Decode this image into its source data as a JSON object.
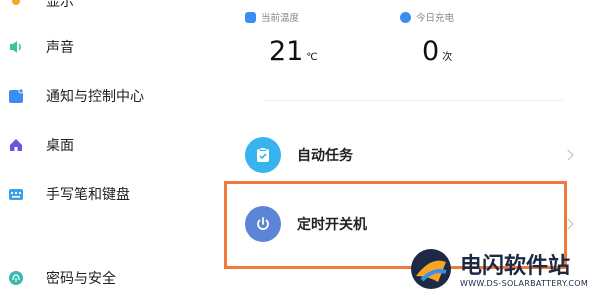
{
  "sidebar": {
    "items": [
      {
        "label": "显示",
        "icon": "sun-icon",
        "color": "#f5a623"
      },
      {
        "label": "声音",
        "icon": "speaker-icon",
        "color": "#3cc48a"
      },
      {
        "label": "通知与控制中心",
        "icon": "notification-icon",
        "color": "#3a8ef0"
      },
      {
        "label": "桌面",
        "icon": "home-icon",
        "color": "#6b55e0"
      },
      {
        "label": "手写笔和键盘",
        "icon": "keyboard-icon",
        "color": "#3aa0e8"
      },
      {
        "label": "密码与安全",
        "icon": "fingerprint-icon",
        "color": "#3cb8b0"
      }
    ]
  },
  "stats": {
    "temperature": {
      "label": "当前温度",
      "value": "21",
      "unit": "℃",
      "icon": "thermometer-icon",
      "color": "#3a8ef0"
    },
    "charge": {
      "label": "今日充电",
      "value": "0",
      "unit": "次",
      "icon": "battery-icon",
      "color": "#3a8ef0"
    }
  },
  "rows": [
    {
      "label": "自动任务",
      "icon": "clipboard-check-icon",
      "color": "#37b4f0"
    },
    {
      "label": "定时开关机",
      "icon": "power-icon",
      "color": "#5b86d8"
    }
  ],
  "watermark": {
    "title": "电闪软件站",
    "subtitle": "WWW.DS-SOLARBATTERY.COM"
  },
  "colors": {
    "highlight": "#f07a3c"
  }
}
